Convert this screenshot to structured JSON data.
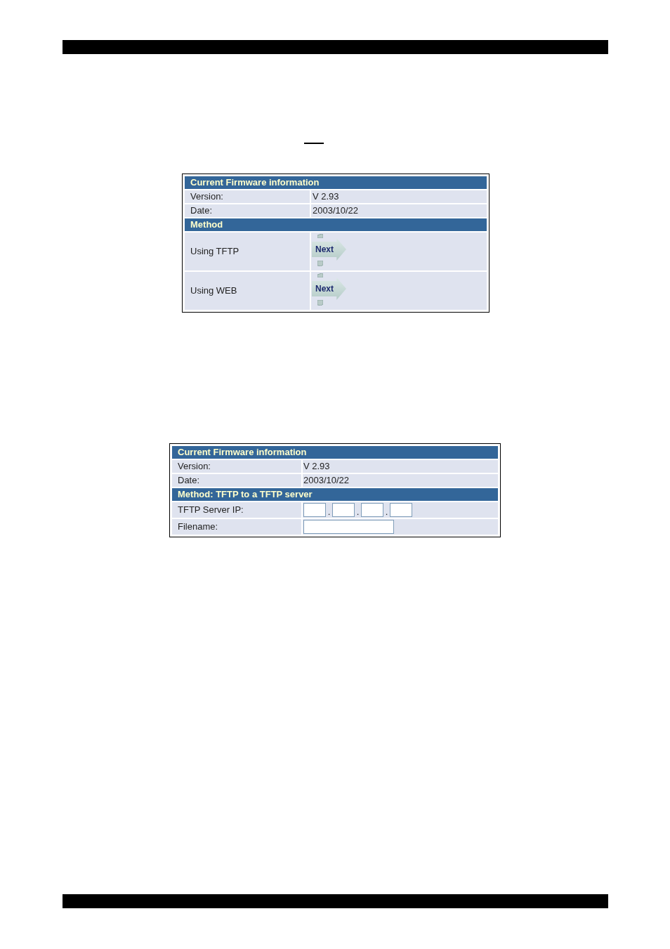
{
  "panels": [
    {
      "sections": [
        {
          "title": "Current Firmware information",
          "rows": [
            {
              "kind": "text",
              "label": "Version:",
              "value": "V 2.93"
            },
            {
              "kind": "text",
              "label": "Date:",
              "value": "2003/10/22"
            }
          ]
        },
        {
          "title": "Method",
          "rows": [
            {
              "kind": "next",
              "label": "Using TFTP",
              "button": "Next"
            },
            {
              "kind": "next",
              "label": "Using WEB",
              "button": "Next"
            }
          ]
        }
      ]
    },
    {
      "sections": [
        {
          "title": "Current Firmware information",
          "rows": [
            {
              "kind": "text",
              "label": "Version:",
              "value": "V 2.93"
            },
            {
              "kind": "text",
              "label": "Date:",
              "value": "2003/10/22"
            }
          ]
        },
        {
          "title": "Method: TFTP to a TFTP server",
          "rows": [
            {
              "kind": "ip",
              "label": "TFTP Server IP:",
              "separators": [
                ".",
                ".",
                "."
              ]
            },
            {
              "kind": "input",
              "label": "Filename:"
            }
          ]
        }
      ]
    }
  ]
}
